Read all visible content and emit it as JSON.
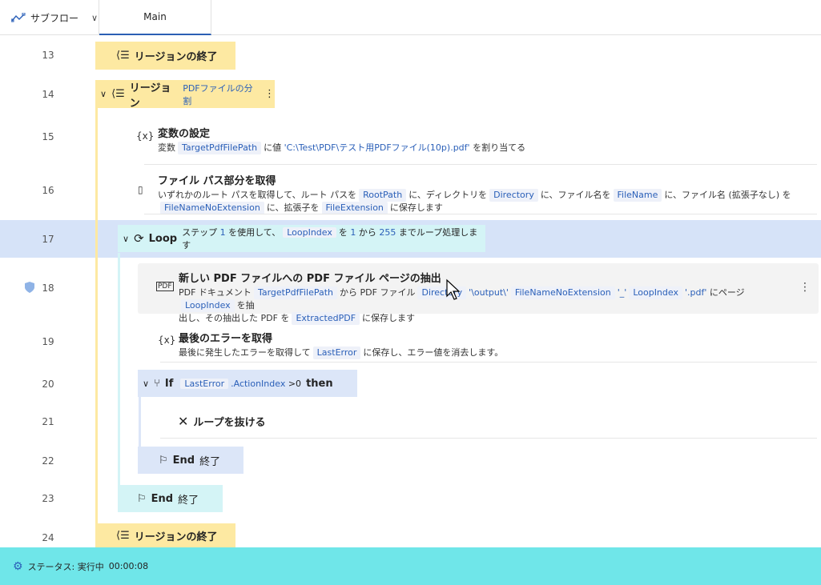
{
  "header": {
    "subflow_label": "サブフロー",
    "main_tab": "Main"
  },
  "lines": [
    "13",
    "14",
    "15",
    "16",
    "17",
    "18",
    "19",
    "20",
    "21",
    "22",
    "23",
    "24"
  ],
  "region_end_1": "リージョンの終了",
  "region": {
    "label": "リージョン",
    "name": "PDFファイルの分割"
  },
  "set_var": {
    "title": "変数の設定",
    "d1": "変数",
    "var": "TargetPdfFilePath",
    "d2": "に値",
    "value": "'C:\\Test\\PDF\\テスト用PDFファイル(10p).pdf'",
    "d3": "を割り当てる"
  },
  "get_path": {
    "title": "ファイル パス部分を取得",
    "d1": "いずれかのルート パスを取得して、ルート パスを",
    "v1": "RootPath",
    "d2": "に、ディレクトリを",
    "v2": "Directory",
    "d3": "に、ファイル名を",
    "v3": "FileName",
    "d4": "に、ファイル名 (拡張子なし) を",
    "v4": "FileNameNoExtension",
    "d5": "に、拡張子を",
    "v5": "FileExtension",
    "d6": "に保存します"
  },
  "loop": {
    "kw": "Loop",
    "d1": "ステップ",
    "step": "1",
    "d2": "を使用して、",
    "var": "LoopIndex",
    "d3": "を",
    "from": "1",
    "d4": "から",
    "to": "255",
    "d5": "までループ処理します"
  },
  "extract": {
    "title": "新しい PDF ファイルへの PDF ファイル ページの抽出",
    "d1": "PDF ドキュメント",
    "v1": "TargetPdfFilePath",
    "d2": "から PDF ファイル",
    "v2": "Directory",
    "d3": "'\\output\\'",
    "v3": "FileNameNoExtension",
    "d4": "'_'",
    "v4": "LoopIndex",
    "d5": "'.pdf'",
    "d6": "にページ",
    "v5": "LoopIndex",
    "d7": "を抽",
    "d8": "出し、その抽出した PDF を",
    "v6": "ExtractedPDF",
    "d9": "に保存します"
  },
  "last_error": {
    "title": "最後のエラーを取得",
    "d1": "最後に発生したエラーを取得して",
    "v1": "LastError",
    "d2": "に保存し、エラー値を消去します。"
  },
  "if_block": {
    "kw": "If",
    "var": "LastError",
    "prop": ".ActionIndex",
    "op": ">0",
    "then": "then"
  },
  "exit_loop": "ループを抜ける",
  "end_if": {
    "kw": "End",
    "label": "終了"
  },
  "end_loop": {
    "kw": "End",
    "label": "終了"
  },
  "region_end_2": "リージョンの終了",
  "status": {
    "label": "ステータス: 実行中",
    "time": "00:00:08"
  },
  "colors": {
    "region": "#fde9a2",
    "loop": "#d4f4f6",
    "if": "#dce6f8",
    "status": "#6fe6e9",
    "accent": "#2a5fb8"
  }
}
